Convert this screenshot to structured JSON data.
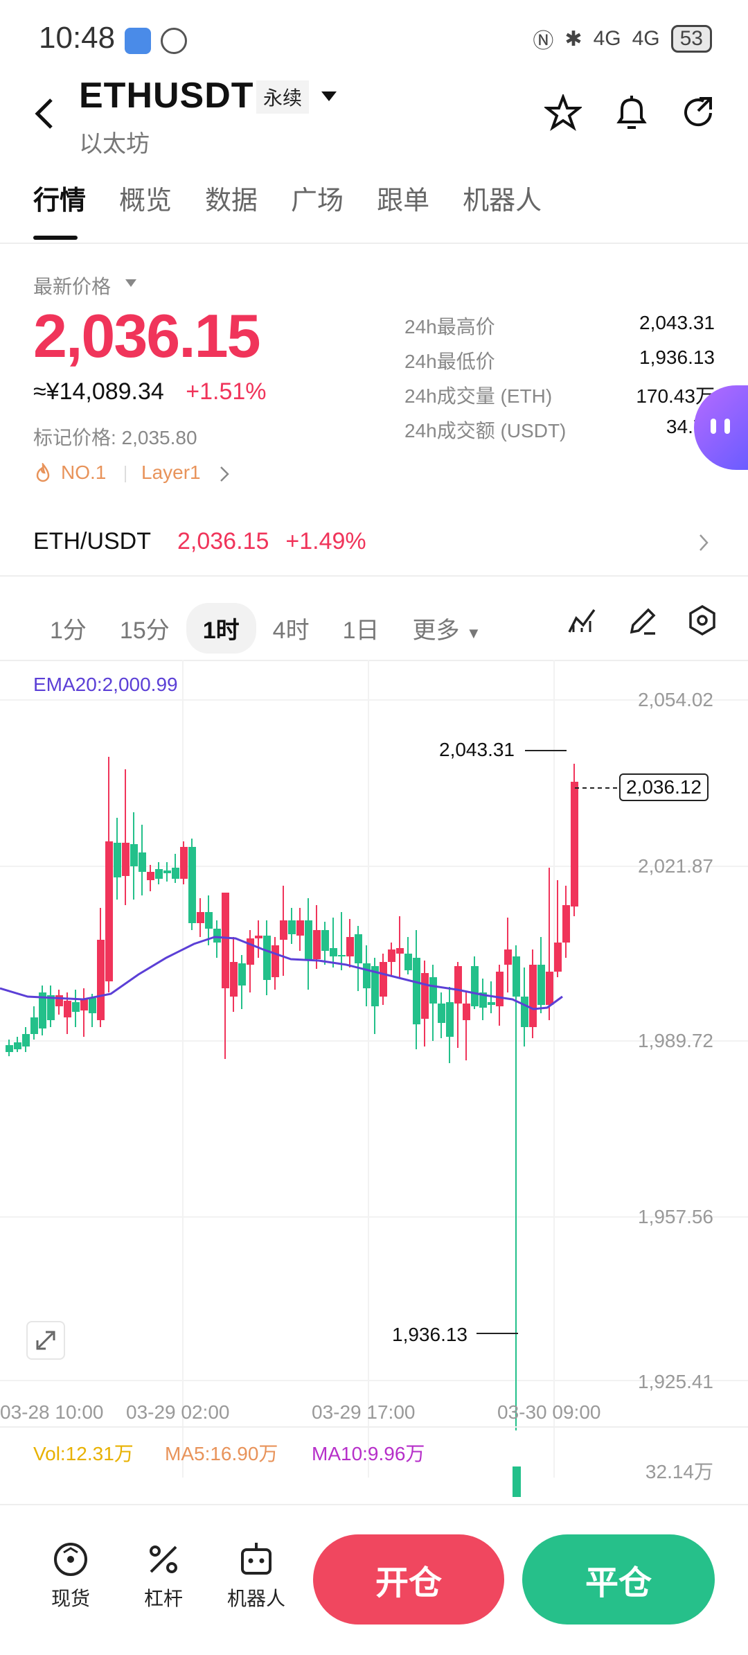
{
  "status": {
    "time": "10:48",
    "signal1": "4G",
    "signal2": "4G",
    "battery": "53"
  },
  "header": {
    "symbol": "ETHUSDT",
    "tag": "永续",
    "name": "以太坊"
  },
  "tabs": [
    "行情",
    "概览",
    "数据",
    "广场",
    "跟单",
    "机器人"
  ],
  "latest": {
    "label": "最新价格",
    "price": "2,036.15",
    "cny": "≈¥14,089.34",
    "change": "+1.51%",
    "mark": "标记价格: 2,035.80",
    "chip1": "NO.1",
    "chip2": "Layer1"
  },
  "stats": [
    {
      "k": "24h最高价",
      "v": "2,043.31"
    },
    {
      "k": "24h最低价",
      "v": "1,936.13"
    },
    {
      "k": "24h成交量 (ETH)",
      "v": "170.43万"
    },
    {
      "k": "24h成交额 (USDT)",
      "v": "34.70"
    }
  ],
  "spot": {
    "pair": "ETH/USDT",
    "price": "2,036.15",
    "change": "+1.49%"
  },
  "intervals": [
    "1分",
    "15分",
    "1时",
    "4时",
    "1日",
    "更多"
  ],
  "chart": {
    "ema": "EMA20:2,000.99",
    "yticks": [
      "2,054.02",
      "2,021.87",
      "1,989.72",
      "1,957.56",
      "1,925.41"
    ],
    "xticks": [
      "03-28 10:00",
      "03-29 02:00",
      "03-29 17:00",
      "03-30 09:00"
    ],
    "high": "2,043.31",
    "low": "1,936.13",
    "current": "2,036.12"
  },
  "volume": {
    "vol": "Vol:12.31万",
    "ma5": "MA5:16.90万",
    "ma10": "MA10:9.96万",
    "max": "32.14万"
  },
  "bottom": {
    "spot": "现货",
    "lev": "杠杆",
    "bot": "机器人",
    "open": "开仓",
    "close": "平仓"
  },
  "colors": {
    "up": "#f0345a",
    "down": "#23c08a",
    "ema": "#5b3fd6"
  }
}
